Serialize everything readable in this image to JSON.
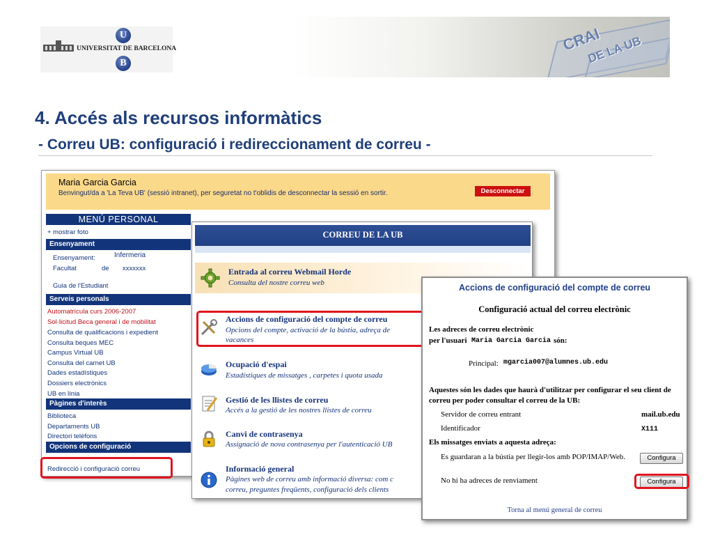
{
  "slide": {
    "title": "4. Accés als recursos informàtics",
    "subtitle": "- Correu UB: configuració i redireccionament de correu  -"
  },
  "logos": {
    "university_name": "UNIVERSITAT DE BARCELONA",
    "u_letter": "U",
    "b_letter": "B",
    "crai_line1": "CRAI",
    "crai_line2": "DE LA UB"
  },
  "intranet": {
    "user_name": "Maria Garcia Garcia",
    "welcome": "Benvingut/da a 'La Teva UB' (sessió intranet), per seguretat no t'oblidis de desconnectar la sessió en sortir.",
    "logout_label": "Desconnectar",
    "menu_title": "MENÚ PERSONAL",
    "show_photo": "+ mostrar foto",
    "sec_ensenyament": "Ensenyament",
    "ensenyament_label": "Ensenyament:",
    "ensenyament_value": "Infermeria",
    "facultat_label": "Facultat",
    "facultat_de": "de",
    "facultat_value": "xxxxxxx",
    "guia": "Guia de l'Estudiant",
    "sec_serveis": "Serveis personals",
    "serveis": [
      "Automatrícula curs 2006-2007",
      "Sol·licitud Beca general i de mobilitat",
      "Consulta de qualificacions i expedient",
      "Consulta beques MEC",
      "Campus Virtual UB",
      "Consulta del carnet UB",
      "Dades estadístiques",
      "Dossiers electrònics",
      "UB en línia"
    ],
    "sec_pagines": "Pàgines d'interès",
    "pagines": [
      "Biblioteca",
      "Departaments UB",
      "Directori telèfons"
    ],
    "sec_opcions": "Opcions de configuració",
    "redireccio": "Redirecció i configuració correu"
  },
  "correu": {
    "header": "CORREU DE LA UB",
    "webmail_title": "Entrada al correu Webmail Horde",
    "webmail_desc": "Consulta del nostre correu web",
    "accions_title": "Accions de configuració del compte de correu",
    "accions_desc1": "Opcions del compte, activació de la bústia, adreça de",
    "accions_desc2": "vacances",
    "espai_title": "Ocupació d'espai",
    "espai_desc": "Estadístiques de missatges , carpetes i quota usada",
    "llistes_title": "Gestió de les llistes de correu",
    "llistes_desc": "Accés a la gestió de les nostres llistes de correu",
    "contrasenya_title": "Canvi de contrasenya",
    "contrasenya_desc": "Assignació de nova contrasenya per l'autenticació UB",
    "info_title": "Informació general",
    "info_desc1": "Pàgines web de correu amb informació diversa: com c",
    "info_desc2": "correu, preguntes freqüents, configuració dels clients"
  },
  "config": {
    "window_title": "Accions de configuració del compte de correu",
    "current_title": "Configuració actual del correu electrònic",
    "addresses_line1": "Les adreces de correu electrònic",
    "addresses_line2_prefix": "per l'usuari",
    "addresses_user": "Maria Garcia Garcia",
    "addresses_line2_suffix": "són:",
    "principal_label": "Principal:",
    "principal_value": "mgarcia007@alumnes.ub.edu",
    "client_line1": "Aquestes són les dades que haurà d'utilitzar per configurar el seu client de",
    "client_line2": "correu per poder consultar el correu de la UB:",
    "server_label": "Servidor de correu entrant",
    "server_value": "mail.ub.edu",
    "id_label": "Identificador",
    "id_value": "X111",
    "sent_heading": "Els missatges enviats a aquesta adreça:",
    "stored_text": "Es guardaran a la bústia per llegir-los amb POP/IMAP/Web.",
    "configure_label_1": "Configura",
    "no_forward_text": "No hi ha adreces de renviament",
    "configure_label_2": "Configura",
    "back_link": "Torna al menú general de correu"
  },
  "colors": {
    "title_blue": "#1f3f7a",
    "menu_blue": "#12347a",
    "highlight_red": "#e0141e",
    "welcome_bg": "#fbd98a"
  }
}
